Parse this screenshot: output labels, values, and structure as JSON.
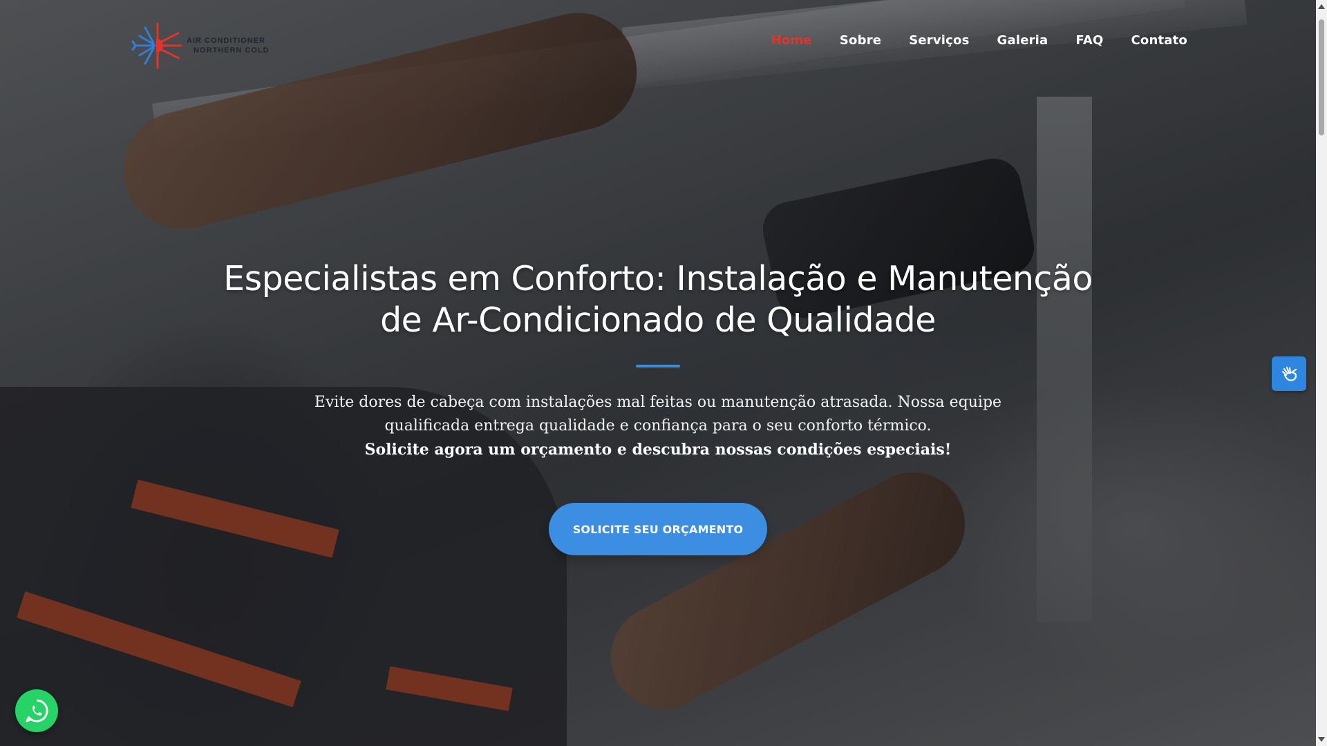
{
  "brand": {
    "logo_line1": "AIR CONDITIONER",
    "logo_line2": "NORTHERN COLD",
    "accent_red": "#e2342a",
    "accent_blue": "#3b8de0"
  },
  "nav": {
    "items": [
      {
        "label": "Home",
        "active": true
      },
      {
        "label": "Sobre",
        "active": false
      },
      {
        "label": "Serviços",
        "active": false
      },
      {
        "label": "Galeria",
        "active": false
      },
      {
        "label": "FAQ",
        "active": false
      },
      {
        "label": "Contato",
        "active": false
      }
    ]
  },
  "hero": {
    "title": "Especialistas em Conforto: Instalação e Manutenção de Ar-Condicionado de Qualidade",
    "description": "Evite dores de cabeça com instalações mal feitas ou manutenção atrasada. Nossa equipe qualificada entrega qualidade e confiança para o seu conforto térmico.",
    "cta_text": "Solicite agora um orçamento e descubra nossas condições especiais!",
    "button_label": "SOLICITE SEU ORÇAMENTO"
  },
  "widgets": {
    "accessibility_icon": "sign-language-hand-icon",
    "whatsapp_icon": "whatsapp-icon",
    "whatsapp_color": "#25d366"
  }
}
